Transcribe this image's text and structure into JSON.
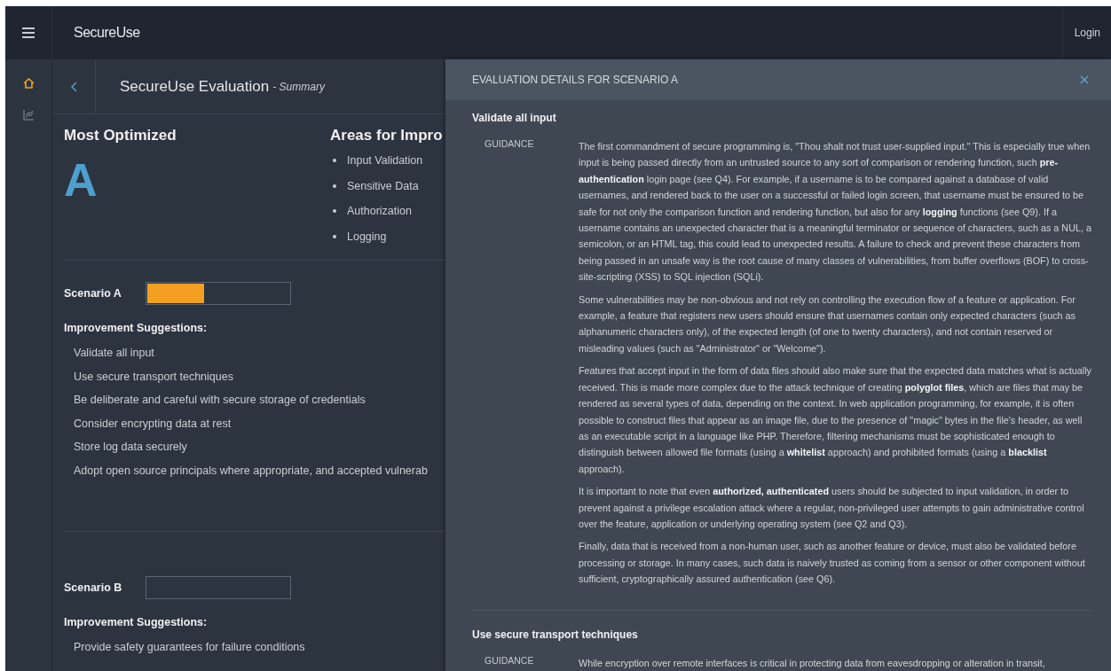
{
  "topbar": {
    "logo": "SecureUse",
    "login": "Login"
  },
  "rail": {
    "items": [
      {
        "kind": "home",
        "selected": true
      },
      {
        "kind": "chart",
        "selected": false
      }
    ]
  },
  "header": {
    "title": "SecureUse Evaluation",
    "subtitle": "- Summary"
  },
  "summary": {
    "optimized_label": "Most Optimized",
    "grade": "A",
    "areas_title": "Areas for Impro",
    "areas": [
      "Input Validation",
      "Sensitive Data",
      "Authorization",
      "Logging"
    ]
  },
  "scenarios": [
    {
      "name": "Scenario A",
      "level": 0.4,
      "suggestions_title": "Improvement Suggestions:",
      "suggestions": [
        "Validate all input",
        "Use secure transport techniques",
        "Be deliberate and careful with secure storage of credentials",
        "Consider encrypting data at rest",
        "Store log data securely",
        "Adopt open source principals where appropriate, and accepted vulnerab"
      ]
    },
    {
      "name": "Scenario B",
      "level": 0,
      "suggestions_title": "Improvement Suggestions:",
      "suggestions": [
        "Provide safety guarantees for failure conditions"
      ]
    }
  ],
  "details": {
    "title": "EVALUATION DETAILS FOR SCENARIO A",
    "sections": [
      {
        "title": "Validate all input",
        "label": "GUIDANCE",
        "paragraphs": [
          "The first commandment of secure programming is, \"Thou shalt not trust user-supplied input.\" This is especially true when input is being passed directly from an untrusted source to any sort of comparison or rendering function, such **pre-authentication** login page (see Q4). For example, if a username is to be compared against a database of valid usernames, and rendered back to the user on a successful or failed login screen, that username must be ensured to be safe for not only the comparison function and rendering function, but also for any **logging** functions (see Q9). If a username contains an unexpected character that is a meaningful terminator or sequence of characters, such as a NUL, a semicolon, or an HTML tag, this could lead to unexpected results. A failure to check and prevent these characters from being passed in an unsafe way is the root cause of many classes of vulnerabilities, from buffer overflows (BOF) to cross-site-scripting (XSS) to SQL injection (SQLi).",
          "Some vulnerabilities may be non-obvious and not rely on controlling the execution flow of a feature or application. For example, a feature that registers new users should ensure that usernames contain only expected characters (such as alphanumeric characters only), of the expected length (of one to twenty characters), and not contain reserved or misleading values (such as \"Administrator\" or \"Welcome\").",
          "Features that accept input in the form of data files should also make sure that the expected data matches what is actually received. This is made more complex due to the attack technique of creating **polyglot files**, which are files that may be rendered as several types of data, depending on the context. In web application programming, for example, it is often possible to construct files that appear as an image file, due to the presence of \"magic\" bytes in the file's header, as well as an executable script in a language like PHP. Therefore, filtering mechanisms must be sophisticated enough to distinguish between allowed file formats (using a **whitelist** approach) and prohibited formats (using a **blacklist** approach).",
          "It is important to note that even **authorized, authenticated** users should be subjected to input validation, in order to prevent against a privilege escalation attack where a regular, non-privileged user attempts to gain administrative control over the feature, application or underlying operating system (see Q2 and Q3).",
          "Finally, data that is received from a non-human user, such as another feature or device, must also be validated before processing or storage. In many cases, such data is naively trusted as coming from a sensor or other component without sufficient, cryptographically assured authentication (see Q6)."
        ]
      },
      {
        "title": "Use secure transport techniques",
        "label": "GUIDANCE",
        "paragraphs": [
          "While encryption over remote interfaces is critical in protecting data from eavesdropping or alteration in transit,"
        ]
      }
    ]
  }
}
